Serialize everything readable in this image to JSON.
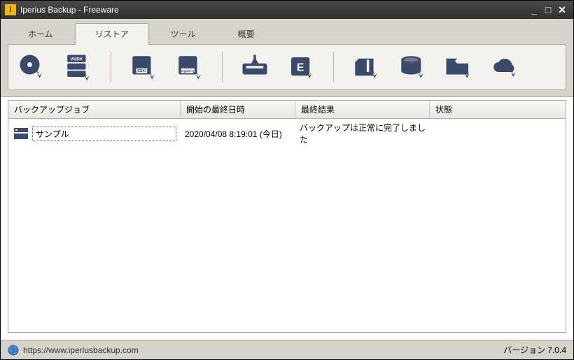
{
  "window": {
    "title": "Iperius Backup - Freeware",
    "app_icon_letter": "I"
  },
  "tabs": {
    "home": "ホーム",
    "restore": "リストア",
    "tools": "ツール",
    "overview": "概要"
  },
  "toolbar_icons": {
    "group1": [
      "disc-restore",
      "vmdk-restore"
    ],
    "group2": [
      "esxi-restore",
      "hyperv-restore"
    ],
    "group3": [
      "tape-restore",
      "exchange-restore"
    ],
    "group4": [
      "zip-restore",
      "sql-restore",
      "folder-restore",
      "cloud-restore"
    ]
  },
  "columns": {
    "job": "バックアップジョブ",
    "last_start": "開始の最終日時",
    "last_result": "最終結果",
    "state": "状態"
  },
  "rows": [
    {
      "name": "サンプル",
      "last_start": "2020/04/08 8:19:01 (今日)",
      "last_result": "バックアップは正常に完了しました",
      "state": ""
    }
  ],
  "status": {
    "url": "https://www.iperiusbackup.com",
    "version_label": "バージョン",
    "version": "7.0.4"
  },
  "colors": {
    "icon": "#3a4a6b"
  }
}
